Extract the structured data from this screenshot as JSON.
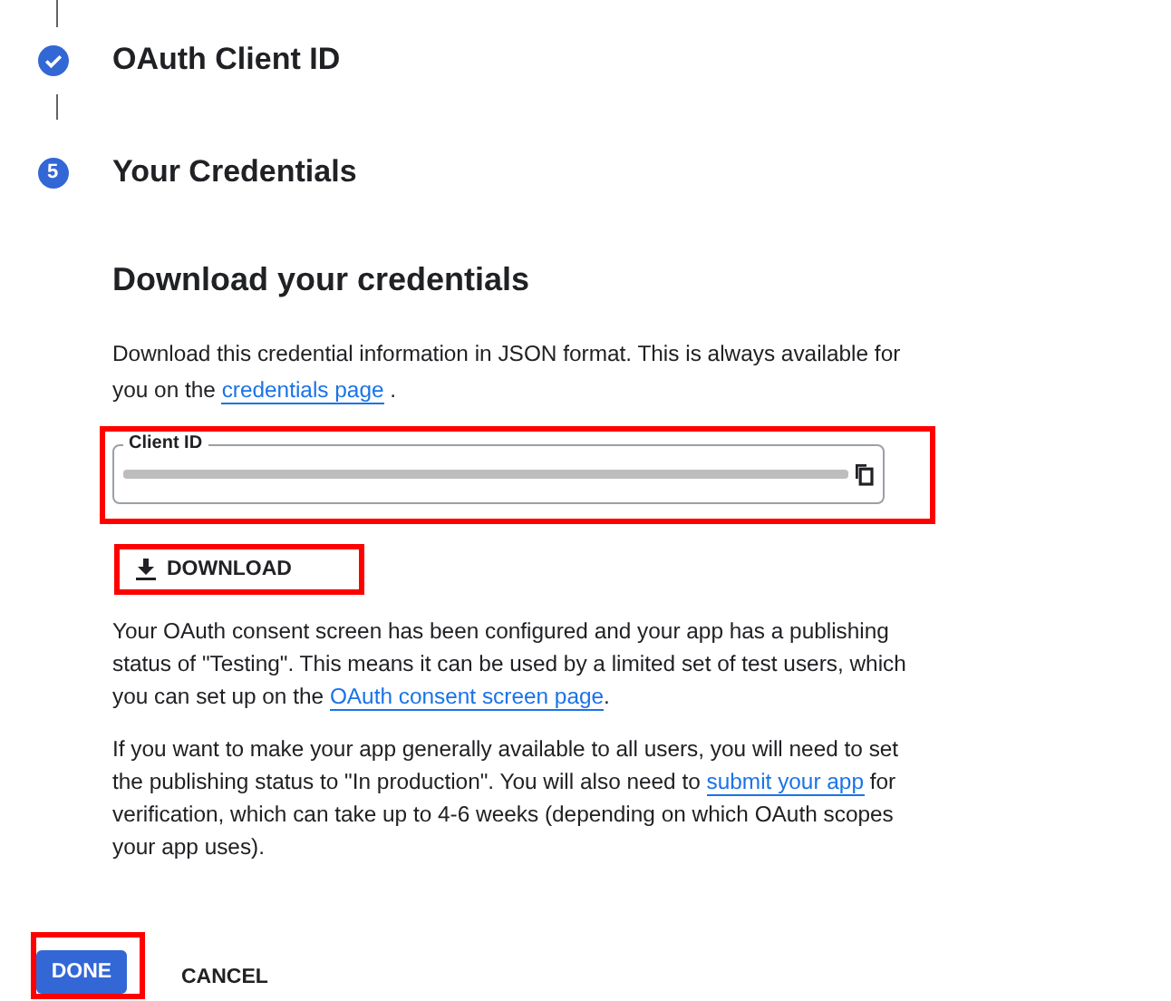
{
  "steps": [
    {
      "completed": true,
      "title": "OAuth Client ID"
    },
    {
      "completed": false,
      "number": "5",
      "title": "Your Credentials"
    }
  ],
  "section": {
    "heading": "Download your credentials",
    "intro": [
      {
        "text": "Download this credential information in JSON format. This is always available for you on the "
      },
      {
        "link": "credentials page"
      },
      {
        "text": " ."
      }
    ],
    "client_id": {
      "label": "Client ID",
      "redacted": true,
      "highlighted": true
    },
    "download_button": {
      "label": "DOWNLOAD",
      "highlighted": true
    },
    "paragraphs": [
      [
        {
          "text": "Your OAuth consent screen has been configured and your app has a publishing status of \"Testing\". This means it can be used by a limited set of test users, which you can set up on the "
        },
        {
          "link": "OAuth consent screen page"
        },
        {
          "text": "."
        }
      ],
      [
        {
          "text": "If you want to make your app generally available to all users, you will need to set the publishing status to \"In production\". You will also need to "
        },
        {
          "link": "submit your app"
        },
        {
          "text": " for verification, which can take up to 4-6 weeks (depending on which OAuth scopes your app uses)."
        }
      ]
    ]
  },
  "actions": [
    {
      "label": "DONE",
      "kind": "primary",
      "highlighted": true
    },
    {
      "label": "CANCEL",
      "kind": "text",
      "highlighted": false
    }
  ]
}
